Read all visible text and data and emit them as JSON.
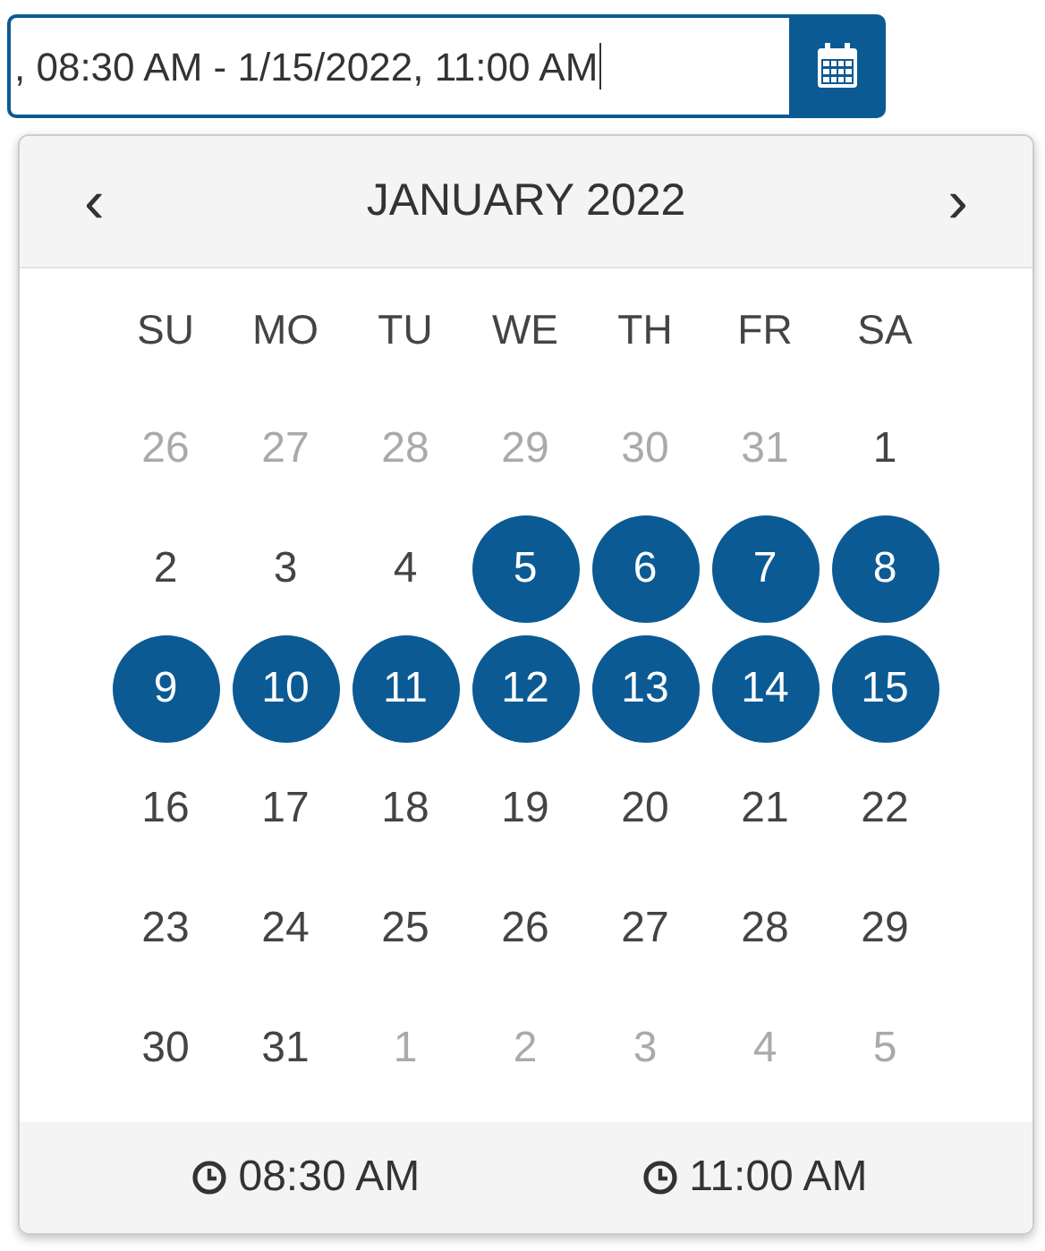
{
  "input": {
    "value": ", 08:30 AM - 1/15/2022, 11:00 AM"
  },
  "calendar": {
    "prev": "‹",
    "title": "JANUARY 2022",
    "next": "›",
    "weekdays": [
      "SU",
      "MO",
      "TU",
      "WE",
      "TH",
      "FR",
      "SA"
    ],
    "weeks": [
      [
        {
          "label": "26",
          "other_month": true,
          "selected": false
        },
        {
          "label": "27",
          "other_month": true,
          "selected": false
        },
        {
          "label": "28",
          "other_month": true,
          "selected": false
        },
        {
          "label": "29",
          "other_month": true,
          "selected": false
        },
        {
          "label": "30",
          "other_month": true,
          "selected": false
        },
        {
          "label": "31",
          "other_month": true,
          "selected": false
        },
        {
          "label": "1",
          "other_month": false,
          "selected": false
        }
      ],
      [
        {
          "label": "2",
          "other_month": false,
          "selected": false
        },
        {
          "label": "3",
          "other_month": false,
          "selected": false
        },
        {
          "label": "4",
          "other_month": false,
          "selected": false
        },
        {
          "label": "5",
          "other_month": false,
          "selected": true
        },
        {
          "label": "6",
          "other_month": false,
          "selected": true
        },
        {
          "label": "7",
          "other_month": false,
          "selected": true
        },
        {
          "label": "8",
          "other_month": false,
          "selected": true
        }
      ],
      [
        {
          "label": "9",
          "other_month": false,
          "selected": true
        },
        {
          "label": "10",
          "other_month": false,
          "selected": true
        },
        {
          "label": "11",
          "other_month": false,
          "selected": true
        },
        {
          "label": "12",
          "other_month": false,
          "selected": true
        },
        {
          "label": "13",
          "other_month": false,
          "selected": true
        },
        {
          "label": "14",
          "other_month": false,
          "selected": true
        },
        {
          "label": "15",
          "other_month": false,
          "selected": true
        }
      ],
      [
        {
          "label": "16",
          "other_month": false,
          "selected": false
        },
        {
          "label": "17",
          "other_month": false,
          "selected": false
        },
        {
          "label": "18",
          "other_month": false,
          "selected": false
        },
        {
          "label": "19",
          "other_month": false,
          "selected": false
        },
        {
          "label": "20",
          "other_month": false,
          "selected": false
        },
        {
          "label": "21",
          "other_month": false,
          "selected": false
        },
        {
          "label": "22",
          "other_month": false,
          "selected": false
        }
      ],
      [
        {
          "label": "23",
          "other_month": false,
          "selected": false
        },
        {
          "label": "24",
          "other_month": false,
          "selected": false
        },
        {
          "label": "25",
          "other_month": false,
          "selected": false
        },
        {
          "label": "26",
          "other_month": false,
          "selected": false
        },
        {
          "label": "27",
          "other_month": false,
          "selected": false
        },
        {
          "label": "28",
          "other_month": false,
          "selected": false
        },
        {
          "label": "29",
          "other_month": false,
          "selected": false
        }
      ],
      [
        {
          "label": "30",
          "other_month": false,
          "selected": false
        },
        {
          "label": "31",
          "other_month": false,
          "selected": false
        },
        {
          "label": "1",
          "other_month": true,
          "selected": false
        },
        {
          "label": "2",
          "other_month": true,
          "selected": false
        },
        {
          "label": "3",
          "other_month": true,
          "selected": false
        },
        {
          "label": "4",
          "other_month": true,
          "selected": false
        },
        {
          "label": "5",
          "other_month": true,
          "selected": false
        }
      ]
    ]
  },
  "times": [
    "08:30 AM",
    "11:00 AM"
  ]
}
